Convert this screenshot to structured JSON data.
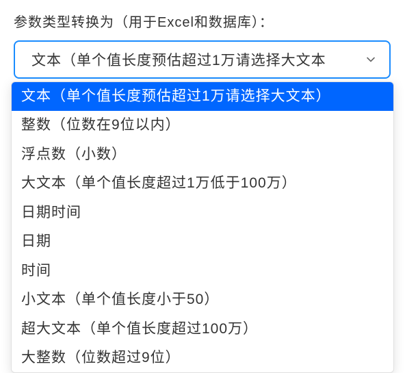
{
  "field": {
    "label": "参数类型转换为（用于Excel和数据库）：",
    "selected_value": "文本（单个值长度预估超过1万请选择大文本",
    "selected_index": 0,
    "options": [
      "文本（单个值长度预估超过1万请选择大文本）",
      "整数（位数在9位以内）",
      "浮点数（小数）",
      "大文本（单个值长度超过1万低于100万）",
      "日期时间",
      "日期",
      "时间",
      "小文本（单个值长度小于50）",
      "超大文本（单个值长度超过100万）",
      "大整数（位数超过9位）"
    ]
  }
}
